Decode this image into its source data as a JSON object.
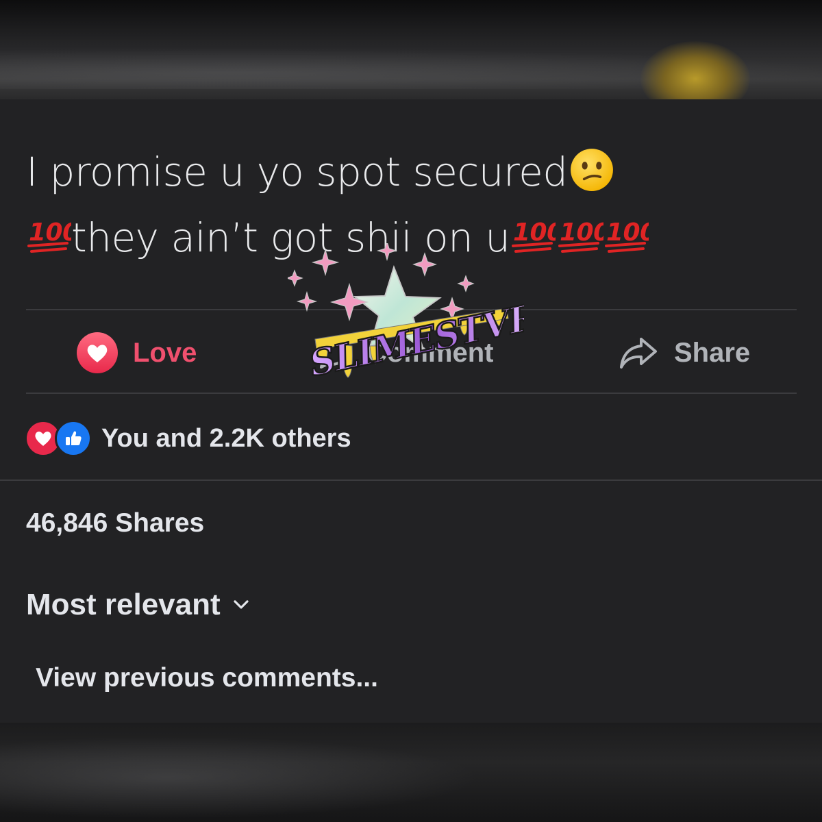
{
  "post": {
    "line1": "I promise u yo spot secured",
    "line2": "they ain’t got shii on u",
    "line1_emoji": "confused-face-icon",
    "hundred_emoji": "hundred-points-icon"
  },
  "actions": {
    "love_label": "Love",
    "comment_label": "Comment",
    "share_label": "Share"
  },
  "reactions": {
    "summary": "You and 2.2K others",
    "types": [
      "love",
      "like"
    ]
  },
  "shares": {
    "count_label": "46,846 Shares"
  },
  "comments": {
    "sort_label": "Most relevant",
    "view_previous": "View previous comments..."
  },
  "watermark": {
    "text": "SLIMESTVR"
  },
  "colors": {
    "background": "#222224",
    "love": "#f0506e",
    "like": "#1877f2",
    "muted": "#b0b3b8",
    "text": "#e4e6eb",
    "hundred": "#e02424"
  }
}
